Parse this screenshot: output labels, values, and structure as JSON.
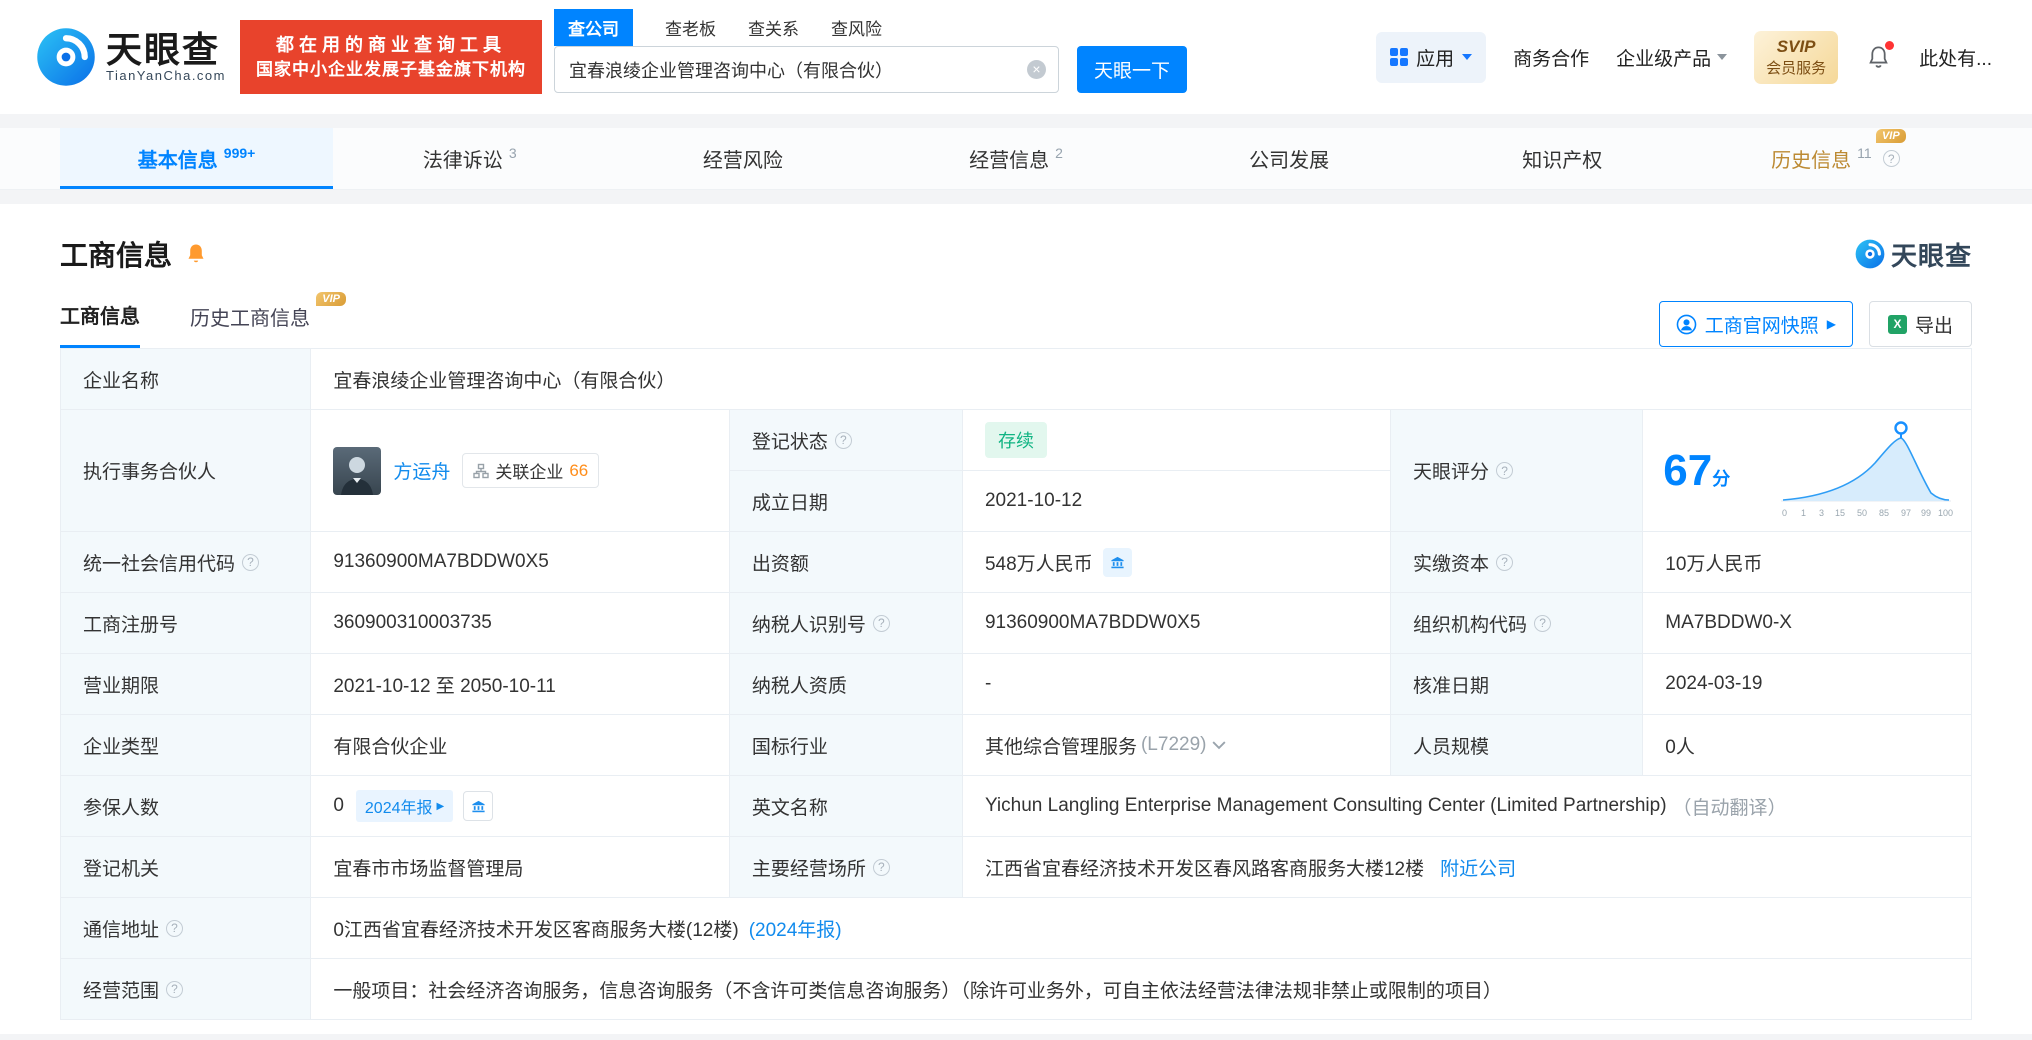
{
  "icons": {
    "help": "?",
    "close": "×",
    "excel": "X",
    "arrow": "▶"
  },
  "header": {
    "brand": "天眼查",
    "brand_domain": "TianYanCha.com",
    "promo_line1": "都在用的商业查询工具",
    "promo_line2": "国家中小企业发展子基金旗下机构",
    "search_tabs": [
      {
        "label": "查公司"
      },
      {
        "label": "查老板"
      },
      {
        "label": "查关系"
      },
      {
        "label": "查风险"
      }
    ],
    "search_value": "宜春浪绫企业管理咨询中心（有限合伙）",
    "search_button": "天眼一下",
    "apps_label": "应用",
    "cooperation": "商务合作",
    "enterprise_products": "企业级产品",
    "svip_top": "SVIP",
    "svip_bottom": "会员服务",
    "username": "此处有..."
  },
  "nav": {
    "tabs": [
      {
        "label": "基本信息",
        "count": "999+"
      },
      {
        "label": "法律诉讼",
        "count": "3"
      },
      {
        "label": "经营风险",
        "count": ""
      },
      {
        "label": "经营信息",
        "count": "2"
      },
      {
        "label": "公司发展",
        "count": ""
      },
      {
        "label": "知识产权",
        "count": ""
      },
      {
        "label": "历史信息",
        "count": "11",
        "vip": "VIP"
      }
    ]
  },
  "section": {
    "title": "工商信息",
    "watermark": "天眼查",
    "tab_current": "工商信息",
    "tab_history": "历史工商信息",
    "vip_tag": "VIP",
    "snapshot_button": "工商官网快照",
    "export_button": "导出"
  },
  "table": {
    "company_name": {
      "label": "企业名称",
      "value": "宜春浪绫企业管理咨询中心（有限合伙）"
    },
    "partner": {
      "label": "执行事务合伙人",
      "name": "方运舟",
      "related_label": "关联企业",
      "related_count": "66"
    },
    "reg_status": {
      "label": "登记状态",
      "value": "存续"
    },
    "establish_date": {
      "label": "成立日期",
      "value": "2021-10-12"
    },
    "score": {
      "label": "天眼评分",
      "value": "67",
      "unit": "分",
      "axis": [
        "0",
        "1",
        "3",
        "15",
        "50",
        "85",
        "97",
        "99",
        "100"
      ]
    },
    "credit_code": {
      "label": "统一社会信用代码",
      "value": "91360900MA7BDDW0X5"
    },
    "capital": {
      "label": "出资额",
      "value": "548万人民币"
    },
    "paid_capital": {
      "label": "实缴资本",
      "value": "10万人民币"
    },
    "reg_no": {
      "label": "工商注册号",
      "value": "360900310003735"
    },
    "taxpayer_no": {
      "label": "纳税人识别号",
      "value": "91360900MA7BDDW0X5"
    },
    "org_code": {
      "label": "组织机构代码",
      "value": "MA7BDDW0-X"
    },
    "business_term": {
      "label": "营业期限",
      "value": "2021-10-12 至 2050-10-11"
    },
    "taxpayer_quality": {
      "label": "纳税人资质",
      "value": "-"
    },
    "approval_date": {
      "label": "核准日期",
      "value": "2024-03-19"
    },
    "company_type": {
      "label": "企业类型",
      "value": "有限合伙企业"
    },
    "industry": {
      "label": "国标行业",
      "value": "其他综合管理服务",
      "code": "(L7229)"
    },
    "staff_size": {
      "label": "人员规模",
      "value": "0人"
    },
    "insured": {
      "label": "参保人数",
      "value": "0",
      "report_tag": "2024年报"
    },
    "english_name": {
      "label": "英文名称",
      "value": "Yichun Langling Enterprise Management Consulting Center (Limited Partnership)",
      "note": "（自动翻译）"
    },
    "registry": {
      "label": "登记机关",
      "value": "宜春市市场监督管理局"
    },
    "premises": {
      "label": "主要经营场所",
      "value": "江西省宜春经济技术开发区春风路客商服务大楼12楼",
      "link": "附近公司"
    },
    "mailing_address": {
      "label": "通信地址",
      "value": "0江西省宜春经济技术开发区客商服务大楼(12楼)",
      "link": "(2024年报)"
    },
    "business_scope": {
      "label": "经营范围",
      "value": "一般项目：社会经济咨询服务，信息咨询服务（不含许可类信息咨询服务）（除许可业务外，可自主依法经营法律法规非禁止或限制的项目）"
    }
  },
  "colors": {
    "brand_blue": "#0084ff",
    "promo_red": "#e8432c",
    "status_green": "#10b483",
    "link_blue": "#128bed",
    "vip_gold": "#d99c35"
  }
}
